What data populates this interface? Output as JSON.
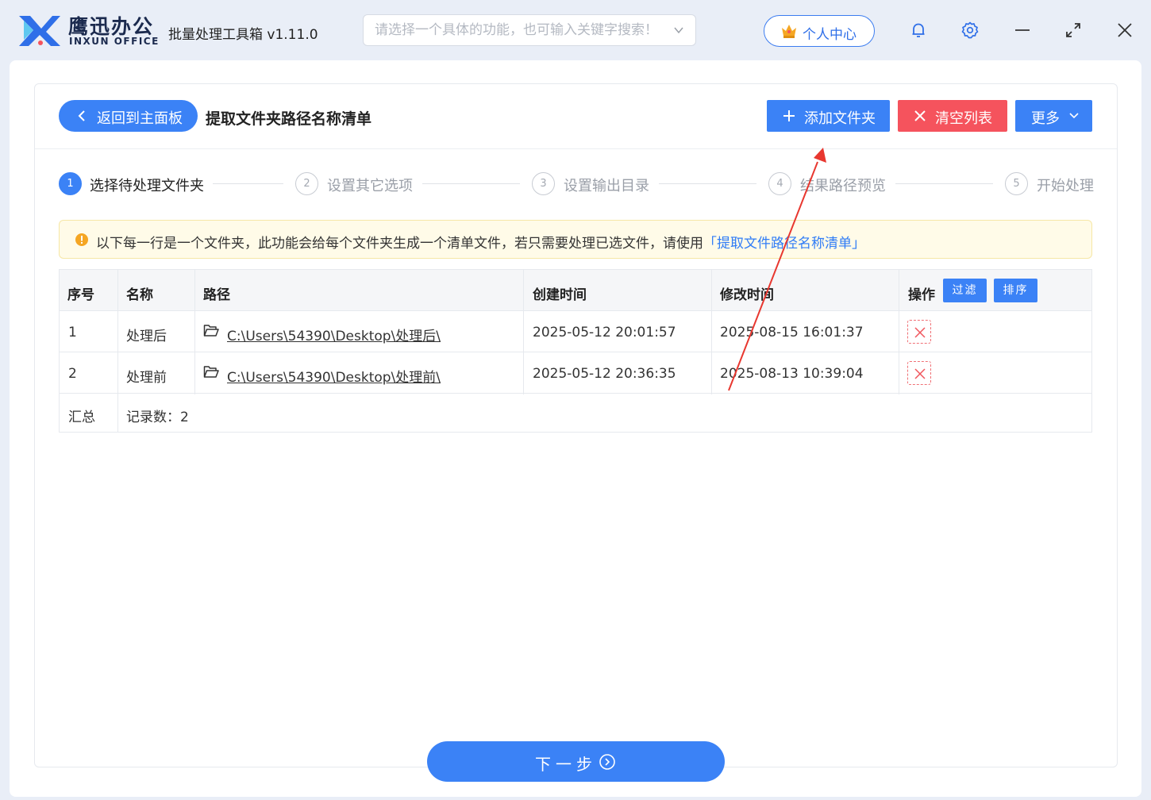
{
  "brand": {
    "name_cn": "鹰迅办公",
    "name_en": "INXUN OFFICE"
  },
  "app": {
    "title": "批量处理工具箱 v1.11.0"
  },
  "search": {
    "placeholder": "请选择一个具体的功能，也可输入关键字搜索！"
  },
  "header": {
    "user_center": "个人中心"
  },
  "toolbar": {
    "back_label": "返回到主面板",
    "page_title": "提取文件夹路径名称清单",
    "add_folder": "添加文件夹",
    "clear_list": "清空列表",
    "more": "更多"
  },
  "steps": [
    {
      "num": "1",
      "label": "选择待处理文件夹",
      "active": true
    },
    {
      "num": "2",
      "label": "设置其它选项",
      "active": false
    },
    {
      "num": "3",
      "label": "设置输出目录",
      "active": false
    },
    {
      "num": "4",
      "label": "结果路径预览",
      "active": false
    },
    {
      "num": "5",
      "label": "开始处理",
      "active": false
    }
  ],
  "notice": {
    "text": "以下每一行是一个文件夹，此功能会给每个文件夹生成一个清单文件，若只需要处理已选文件，请使用",
    "link": "「提取文件路径名称清单」"
  },
  "table": {
    "columns": [
      "序号",
      "名称",
      "路径",
      "创建时间",
      "修改时间",
      "操作"
    ],
    "filter_label": "过滤",
    "sort_label": "排序",
    "rows": [
      {
        "index": "1",
        "name": "处理后",
        "path": "C:\\Users\\54390\\Desktop\\处理后\\",
        "created": "2025-05-12 20:01:57",
        "modified": "2025-08-15 16:01:37"
      },
      {
        "index": "2",
        "name": "处理前",
        "path": "C:\\Users\\54390\\Desktop\\处理前\\",
        "created": "2025-05-12 20:36:35",
        "modified": "2025-08-13 10:39:04"
      }
    ],
    "summary": {
      "label": "汇总",
      "count_text": "记录数：2"
    }
  },
  "footer": {
    "next_label": "下一步"
  },
  "colors": {
    "accent": "#3b82f6",
    "danger": "#f5535d",
    "notice_bg": "#fffbe8",
    "annotation": "#e8372f"
  }
}
